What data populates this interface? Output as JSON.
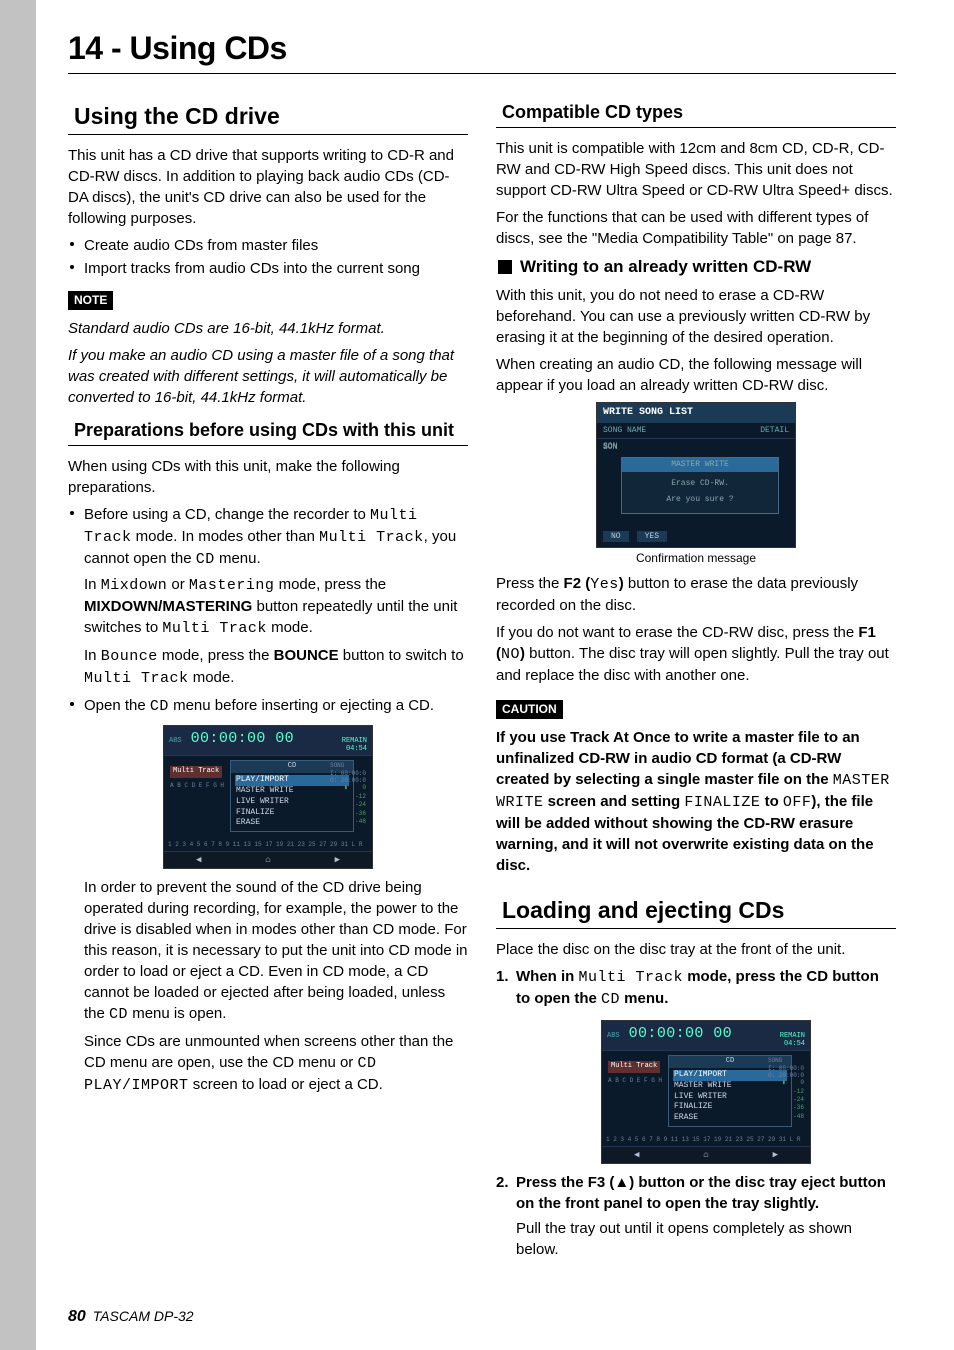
{
  "chapter": {
    "title": "14 - Using CDs"
  },
  "left": {
    "h_using": "Using the CD drive",
    "p_intro": "This unit has a CD drive that supports writing to CD-R and CD-RW discs. In addition to playing back audio CDs (CD-DA discs), the unit's CD drive can also be used for the following purposes.",
    "bul1": "Create audio CDs from master files",
    "bul2": "Import tracks from audio CDs into the current song",
    "note_label": "NOTE",
    "note1": "Standard audio CDs are 16-bit, 44.1kHz format.",
    "note2": "If you make an audio CD using a master file of a song that was created with different settings, it will automatically be converted to 16-bit, 44.1kHz format.",
    "h_prep": "Preparations before using CDs with this unit",
    "p_prep": "When using CDs with this unit, make the following preparations.",
    "prep_b1a": "Before using a CD, change the recorder to ",
    "prep_b1_lcd1": "Multi Track",
    "prep_b1b": " mode. In modes other than ",
    "prep_b1_lcd2": "Multi Track",
    "prep_b1c": ", you cannot open the ",
    "prep_b1_lcd3": "CD",
    "prep_b1d": " menu.",
    "prep_p2a": "In ",
    "prep_p2_lcd1": "Mixdown",
    "prep_p2b": " or ",
    "prep_p2_lcd2": "Mastering",
    "prep_p2c": " mode, press the ",
    "prep_p2_bold": "MIXDOWN/MASTERING",
    "prep_p2d": " button repeatedly until the unit switches to ",
    "prep_p2_lcd3": "Multi Track",
    "prep_p2e": " mode.",
    "prep_p3a": "In ",
    "prep_p3_lcd1": "Bounce",
    "prep_p3b": " mode, press the ",
    "prep_p3_bold": "BOUNCE",
    "prep_p3c": " button to switch to ",
    "prep_p3_lcd2": "Multi Track",
    "prep_p3d": " mode.",
    "prep_b2a": "Open the ",
    "prep_b2_lcd": "CD",
    "prep_b2b": " menu before inserting or ejecting a CD.",
    "p_after1a": "In order to prevent the sound of the CD drive being operated during recording, for example, the power to the drive is disabled when in modes other than CD mode. For this reason, it is necessary to put the unit into CD mode in order to load or eject a CD. Even in CD mode, a CD cannot be loaded or ejected after being loaded, unless the ",
    "p_after1_lcd": "CD",
    "p_after1b": " menu is open.",
    "p_after2a": "Since CDs are unmounted when screens other than the CD menu are open, use the CD menu or ",
    "p_after2_lcd": "CD PLAY/IMPORT",
    "p_after2b": " screen to load or eject a CD."
  },
  "right": {
    "h_compat": "Compatible CD types",
    "p_compat1": "This unit is compatible with 12cm and 8cm CD, CD-R, CD-RW and CD-RW High Speed discs. This unit does not support CD-RW Ultra Speed or CD-RW Ultra Speed+ discs.",
    "p_compat2": "For the functions that can be used with different types of discs, see the \"Media Compatibility Table\" on page 87.",
    "h_writing": "Writing to an already written CD-RW",
    "p_wr1": "With this unit, you do not need to erase a CD-RW beforehand. You can use a previously written CD-RW by erasing it at the beginning of the desired operation.",
    "p_wr2": "When creating an audio CD, the following message will appear if you load an already written CD-RW disc.",
    "caption": "Confirmation message",
    "p_wr3a": "Press the ",
    "p_wr3_b1": "F2 (",
    "p_wr3_lcd": "Yes",
    "p_wr3_b2": ")",
    "p_wr3b": " button to erase the data previously recorded on the disc.",
    "p_wr4a": "If you do not want to erase the CD-RW disc, press the ",
    "p_wr4_b1": "F1 (",
    "p_wr4_lcd": "NO",
    "p_wr4_b2": ")",
    "p_wr4b": " button. The disc tray will open slightly. Pull the tray out and replace the disc with another one.",
    "caution_label": "CAUTION",
    "caution_a": "If you use Track At Once to write a master file to an unfinalized CD-RW in audio CD format (a CD-RW created by selecting a single master file on the ",
    "caution_lcd1": "MASTER WRITE",
    "caution_b": " screen and setting ",
    "caution_lcd2": "FINALIZE",
    "caution_c": " to ",
    "caution_lcd3": "OFF",
    "caution_d": "), the file will be added without showing the CD-RW erasure warning, and it will not overwrite existing data on the disc.",
    "h_loading": "Loading and ejecting CDs",
    "p_load1": "Place the disc on the disc tray at the front of the unit.",
    "ol1_num": "1.",
    "ol1a": "When in ",
    "ol1_lcd1": "Multi Track",
    "ol1b": " mode, press the CD button to open the ",
    "ol1_lcd2": "CD",
    "ol1c": " menu.",
    "ol2_num": "2.",
    "ol2a": "Press the F3 (",
    "ol2eject": "▲",
    "ol2b": ") button or the disc tray eject button on the front panel to open the tray slightly.",
    "ol2_sub": "Pull the tray out until it opens completely as shown below."
  },
  "fig_cd": {
    "abs": "ABS",
    "time": "00:00:00 00",
    "remain_lbl": "REMAIN",
    "remain_val": "04:54",
    "multitrack": "Multi Track",
    "letters": "A B C D E F G H",
    "hdr": "CD",
    "items": [
      "PLAY/IMPORT",
      "MASTER WRITE",
      "LIVE WRITER",
      "FINALIZE",
      "ERASE"
    ],
    "song": "SONG",
    "song1": "I: 00:00:0",
    "song2": "O: 20:00:0",
    "meters": [
      "0",
      "-12",
      "-24",
      "-36",
      "-48"
    ],
    "trackrow": "1 2 3 4 5 6 7 8 9  11  13  15  17  19  21   23 25 27  29 31    L R",
    "tbk": "◀",
    "thome": "⌂",
    "tfw": "▶"
  },
  "fig_confirm": {
    "title": "WRITE SONG LIST",
    "coln": "SONG NAME",
    "cold": "DETAIL",
    "row1": "SON",
    "row2": "SON",
    "dlg_t": "MASTER WRITE",
    "dlg1": "Erase CD-RW.",
    "dlg2": "Are you sure ?",
    "no": "NO",
    "yes": "YES"
  },
  "footer": {
    "page": "80",
    "model": "TASCAM DP-32"
  }
}
